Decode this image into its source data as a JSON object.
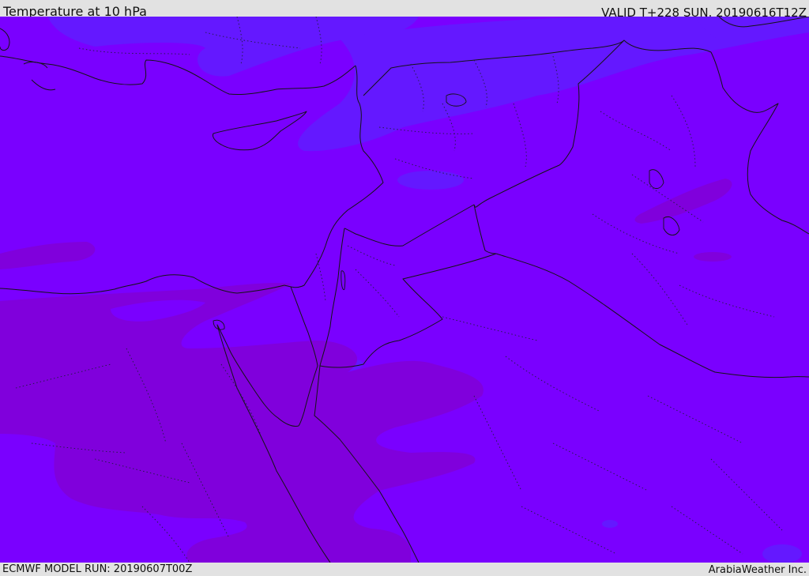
{
  "header": {
    "title": "Temperature at 10 hPa",
    "valid_time": "VALID T+228 SUN. 20190616T12Z"
  },
  "footer": {
    "model_run": "ECMWF MODEL RUN: 20190607T00Z",
    "credit": "ArabiaWeather Inc."
  },
  "map": {
    "colors": {
      "base_fill": "#7a00ff",
      "warm_fill": "#8000dc",
      "cool_fill": "#6418ff",
      "border_line": "#141414"
    }
  }
}
